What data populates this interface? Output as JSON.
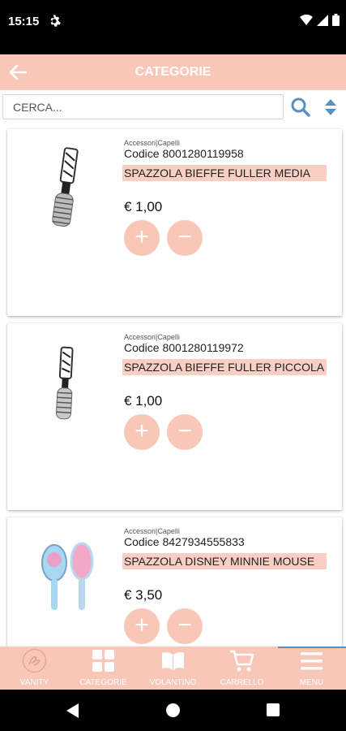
{
  "status_bar": {
    "time": "15:15",
    "icons": [
      "gear-icon",
      "wifi-icon",
      "signal-icon",
      "battery-icon"
    ]
  },
  "app_bar": {
    "title": "CATEGORIE",
    "back_icon": "arrow-left-icon"
  },
  "search": {
    "placeholder": "CERCA...",
    "value": "",
    "search_icon": "search-icon",
    "sort_icon": "sort-icon"
  },
  "products": [
    {
      "category": "Accessori|Capelli",
      "code": "Codice 8001280119958",
      "name": "SPAZZOLA BIEFFE FULLER MEDIA",
      "price": "€ 1,00",
      "plus_label": "+",
      "minus_label": "−"
    },
    {
      "category": "Accessori|Capelli",
      "code": "Codice 8001280119972",
      "name": "SPAZZOLA BIEFFE FULLER PICCOLA",
      "price": "€ 1,00",
      "plus_label": "+",
      "minus_label": "−"
    },
    {
      "category": "Accessori|Capelli",
      "code": "Codice 8427934555833",
      "name": "SPAZZOLA DISNEY MINNIE MOUSE",
      "price": "€ 3,50",
      "plus_label": "+",
      "minus_label": "−"
    }
  ],
  "tab_bar": {
    "items": [
      {
        "label": "VANITY",
        "icon": "vanity-logo-icon"
      },
      {
        "label": "CATEGORIE",
        "icon": "grid-icon"
      },
      {
        "label": "VOLANTINO",
        "icon": "book-icon"
      },
      {
        "label": "CARRELLO",
        "icon": "cart-icon"
      },
      {
        "label": "MENU",
        "icon": "menu-icon"
      }
    ]
  },
  "colors": {
    "accent": "#f9c7b8",
    "label_bg": "#f9cfc3",
    "active_tab_indicator": "#5b8fbf"
  }
}
